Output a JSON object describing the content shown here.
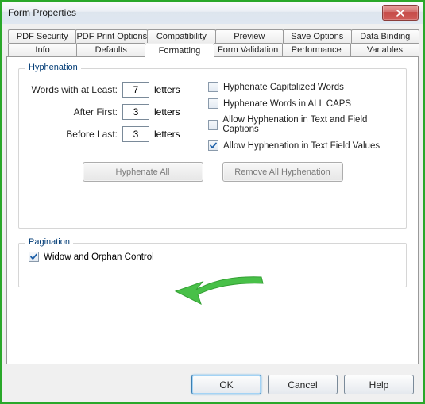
{
  "window": {
    "title": "Form Properties"
  },
  "tabs_row1": [
    {
      "label": "PDF Security"
    },
    {
      "label": "PDF Print Options"
    },
    {
      "label": "Compatibility"
    },
    {
      "label": "Preview"
    },
    {
      "label": "Save Options"
    },
    {
      "label": "Data Binding"
    }
  ],
  "tabs_row2": [
    {
      "label": "Info"
    },
    {
      "label": "Defaults"
    },
    {
      "label": "Formatting",
      "active": true
    },
    {
      "label": "Form Validation"
    },
    {
      "label": "Performance"
    },
    {
      "label": "Variables"
    }
  ],
  "hyphenation": {
    "legend": "Hyphenation",
    "words_at_least_label": "Words with at Least:",
    "words_at_least_value": "7",
    "after_first_label": "After First:",
    "after_first_value": "3",
    "before_last_label": "Before Last:",
    "before_last_value": "3",
    "unit": "letters",
    "chk_cap": {
      "label": "Hyphenate Capitalized Words",
      "checked": false
    },
    "chk_caps": {
      "label": "Hyphenate Words in ALL CAPS",
      "checked": false
    },
    "chk_captions": {
      "label": "Allow Hyphenation in Text and Field Captions",
      "checked": false
    },
    "chk_values": {
      "label": "Allow Hyphenation in Text Field Values",
      "checked": true
    },
    "btn_hyphenate_all": "Hyphenate All",
    "btn_remove_all": "Remove All Hyphenation"
  },
  "pagination": {
    "legend": "Pagination",
    "widow_orphan": {
      "label": "Widow and Orphan Control",
      "checked": true
    }
  },
  "footer": {
    "ok": "OK",
    "cancel": "Cancel",
    "help": "Help"
  }
}
